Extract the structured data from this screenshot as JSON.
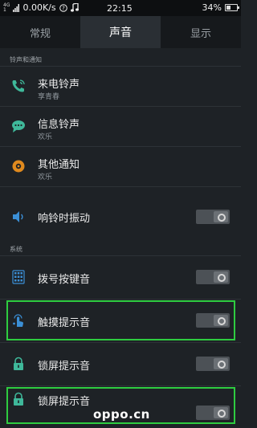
{
  "status_bar": {
    "network_top": "4G",
    "network_bottom": "1",
    "speed": "0.00K/s",
    "time": "22:15",
    "battery": "34%"
  },
  "tabs": [
    {
      "label": "常规",
      "active": false
    },
    {
      "label": "声音",
      "active": true
    },
    {
      "label": "显示",
      "active": false
    }
  ],
  "sections": {
    "ringtones": "铃声和通知",
    "system": "系统"
  },
  "items": {
    "incoming_call": {
      "label": "来电铃声",
      "value": "享青春",
      "icon": "phone-ring-icon"
    },
    "message": {
      "label": "信息铃声",
      "value": "欢乐",
      "icon": "message-icon"
    },
    "other_notice": {
      "label": "其他通知",
      "value": "欢乐",
      "icon": "notification-icon"
    },
    "vibrate_on_ring": {
      "label": "响铃时振动",
      "icon": "speaker-icon",
      "toggle": "off"
    },
    "dial_keypad_tone": {
      "label": "拨号按键音",
      "icon": "keypad-icon",
      "toggle": "off"
    },
    "touch_tone": {
      "label": "触摸提示音",
      "icon": "touch-icon",
      "toggle": "off"
    },
    "lock_tone_1": {
      "label": "锁屏提示音",
      "icon": "lock-icon",
      "toggle": "off"
    },
    "lock_tone_2": {
      "label": "锁屏提示音",
      "icon": "lock-icon",
      "toggle": "off"
    }
  },
  "watermark": "oppo.cn",
  "colors": {
    "accent_green": "#2ecc40",
    "background": "#1e2226"
  }
}
